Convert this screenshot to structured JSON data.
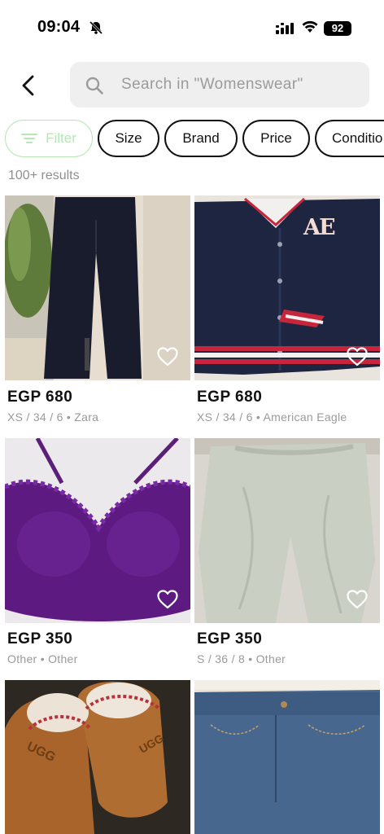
{
  "status_bar": {
    "time": "09:04",
    "battery": "92"
  },
  "search": {
    "placeholder": "Search in \"Womenswear\""
  },
  "chips": {
    "filter": "Filter",
    "size": "Size",
    "brand": "Brand",
    "price": "Price",
    "condition": "Conditio"
  },
  "results": {
    "count": "100+ results"
  },
  "products": [
    {
      "price": "EGP 680",
      "meta": "XS / 34 / 6 • Zara"
    },
    {
      "price": "EGP 680",
      "meta": "XS / 34 / 6 • American Eagle"
    },
    {
      "price": "EGP 350",
      "meta": "Other • Other"
    },
    {
      "price": "EGP 350",
      "meta": "S / 36 / 8 • Other"
    },
    {
      "price": "",
      "meta": ""
    },
    {
      "price": "",
      "meta": ""
    }
  ],
  "image_text": {
    "jacket_logo": "AE",
    "slipper_logo": "UGG"
  },
  "colors": {
    "accent_green": "#b7e6b7",
    "border_dark": "#111111",
    "muted_text": "#9a9a9a",
    "search_bg": "#efefef"
  }
}
